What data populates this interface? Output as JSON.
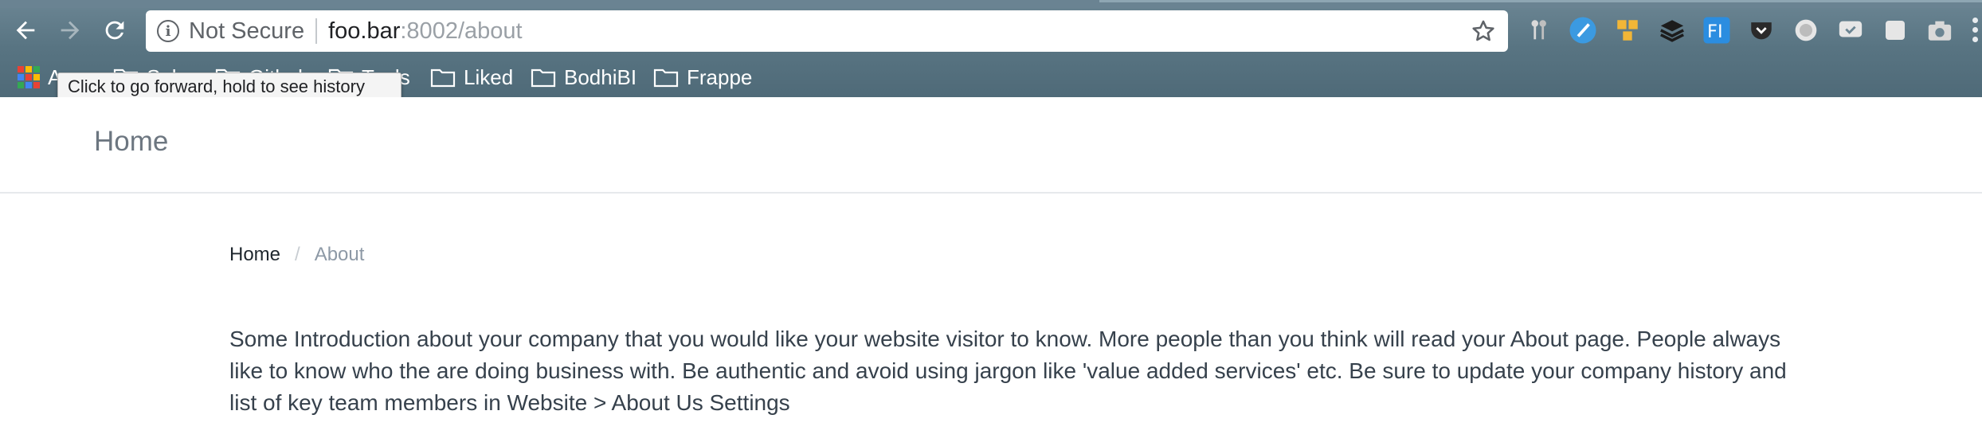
{
  "browser": {
    "security_label": "Not Secure",
    "url_host": "foo.bar",
    "url_path": ":8002/about",
    "tooltip": "Click to go forward, hold to see history",
    "extensions": [
      "keys-icon",
      "edge-blue-icon",
      "honeycomb-icon",
      "layers-icon",
      "fi-icon",
      "pocket-icon",
      "circle-icon",
      "chat-icon",
      "square-icon",
      "camera-icon"
    ]
  },
  "bookmarks": {
    "apps": "Apps",
    "items": [
      "Sales",
      "Github",
      "Tools",
      "Liked",
      "BodhiBI",
      "Frappe"
    ]
  },
  "site": {
    "brand": "Home"
  },
  "breadcrumb": {
    "home": "Home",
    "separator": "/",
    "current": "About"
  },
  "content": {
    "intro": "Some Introduction about your company that you would like your website visitor to know. More people than you think will read your About page. People always like to know who the are doing business with. Be authentic and avoid using jargon like 'value added services' etc. Be sure to update your company history and list of key team members in Website > About Us Settings"
  },
  "colors": {
    "chrome": "#587482",
    "brand_text": "#6c7680",
    "body_text": "#36414c",
    "breadcrumb_muted": "#8d99a6"
  }
}
